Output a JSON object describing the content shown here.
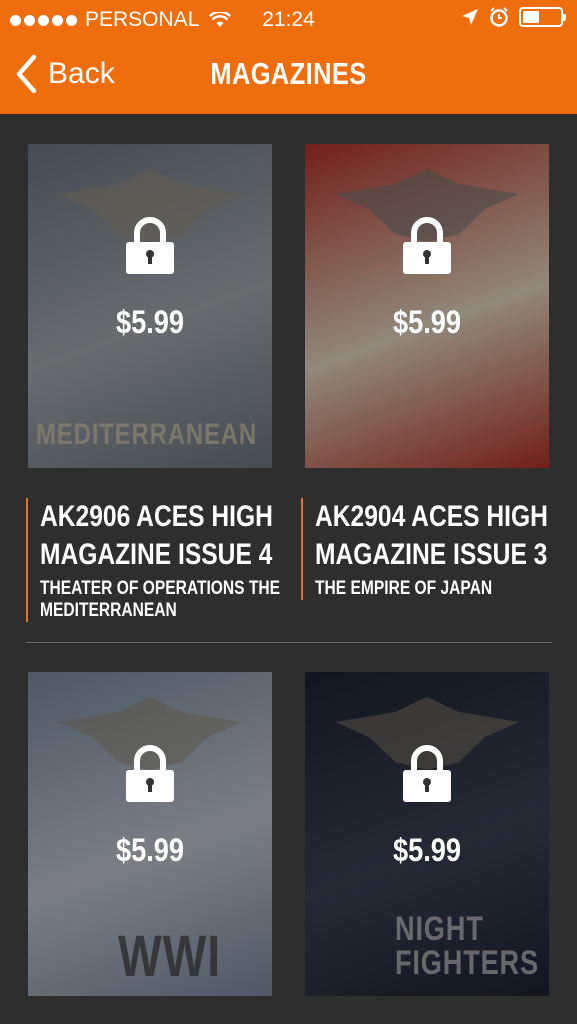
{
  "status_bar": {
    "carrier": "PERSONAL",
    "time": "21:24",
    "battery_level": 0.45
  },
  "nav": {
    "back_label": "Back",
    "title": "MAGAZINES"
  },
  "magazines": [
    {
      "title": "AK2906 ACES HIGH MAGAZINE ISSUE 4",
      "subtitle": "THEATER OF OPERATIONS THE MEDITERRANEAN",
      "price": "$5.99",
      "cover_text": "MEDITERRANEAN",
      "cover_colors": [
        "#6f7a86",
        "#a9aeb3"
      ]
    },
    {
      "title": "AK2904 ACES HIGH MAGAZINE ISSUE 3",
      "subtitle": "THE EMPIRE OF JAPAN",
      "price": "$5.99",
      "cover_text": "",
      "cover_colors": [
        "#b8352c",
        "#e9dcc6"
      ]
    },
    {
      "title": "",
      "subtitle": "",
      "price": "$5.99",
      "cover_text": "WWI",
      "cover_colors": [
        "#7f8fa5",
        "#c7cdd5"
      ]
    },
    {
      "title": "",
      "subtitle": "",
      "price": "$5.99",
      "cover_text": "NIGHT FIGHTERS",
      "cover_colors": [
        "#1e2433",
        "#3c4456"
      ]
    }
  ],
  "colors": {
    "accent": "#ee6d0c",
    "background": "#2e2e2e"
  }
}
